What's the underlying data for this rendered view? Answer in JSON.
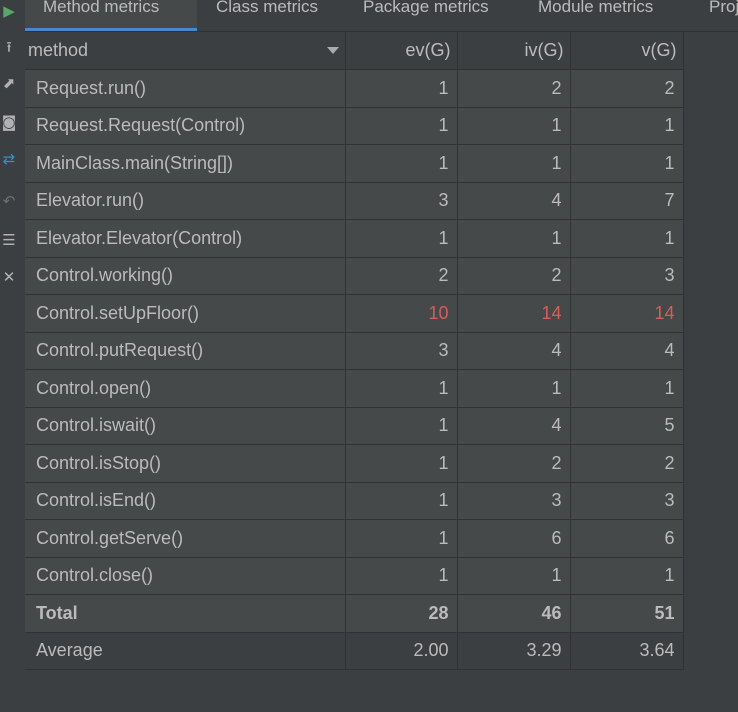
{
  "tabs": [
    {
      "label": "Method metrics",
      "active": true
    },
    {
      "label": "Class metrics",
      "active": false
    },
    {
      "label": "Package metrics",
      "active": false
    },
    {
      "label": "Module metrics",
      "active": false
    },
    {
      "label": "Proj",
      "active": false
    }
  ],
  "toolbar": {
    "icons": [
      "run-icon",
      "export-icon",
      "expand-icon",
      "snapshot-icon",
      "diff-icon",
      "undo-icon",
      "settings-icon",
      "close-icon"
    ]
  },
  "table": {
    "columns": [
      "method",
      "ev(G)",
      "iv(G)",
      "v(G)"
    ],
    "rows": [
      {
        "method": "Request.run()",
        "ev": "1",
        "iv": "2",
        "v": "2"
      },
      {
        "method": "Request.Request(Control)",
        "ev": "1",
        "iv": "1",
        "v": "1"
      },
      {
        "method": "MainClass.main(String[])",
        "ev": "1",
        "iv": "1",
        "v": "1"
      },
      {
        "method": "Elevator.run()",
        "ev": "3",
        "iv": "4",
        "v": "7"
      },
      {
        "method": "Elevator.Elevator(Control)",
        "ev": "1",
        "iv": "1",
        "v": "1"
      },
      {
        "method": "Control.working()",
        "ev": "2",
        "iv": "2",
        "v": "3"
      },
      {
        "method": "Control.setUpFloor()",
        "ev": "10",
        "iv": "14",
        "v": "14",
        "highlight": true
      },
      {
        "method": "Control.putRequest()",
        "ev": "3",
        "iv": "4",
        "v": "4"
      },
      {
        "method": "Control.open()",
        "ev": "1",
        "iv": "1",
        "v": "1"
      },
      {
        "method": "Control.iswait()",
        "ev": "1",
        "iv": "4",
        "v": "5"
      },
      {
        "method": "Control.isStop()",
        "ev": "1",
        "iv": "2",
        "v": "2"
      },
      {
        "method": "Control.isEnd()",
        "ev": "1",
        "iv": "3",
        "v": "3"
      },
      {
        "method": "Control.getServe()",
        "ev": "1",
        "iv": "6",
        "v": "6"
      },
      {
        "method": "Control.close()",
        "ev": "1",
        "iv": "1",
        "v": "1"
      }
    ],
    "total": {
      "label": "Total",
      "ev": "28",
      "iv": "46",
      "v": "51"
    },
    "average": {
      "label": "Average",
      "ev": "2.00",
      "iv": "3.29",
      "v": "3.64"
    }
  },
  "colors": {
    "background": "#45494a",
    "header": "#3c3f41",
    "text": "#bbbbbb",
    "highlight": "#d85c5c",
    "active_tab_underline": "#4a88c7"
  }
}
